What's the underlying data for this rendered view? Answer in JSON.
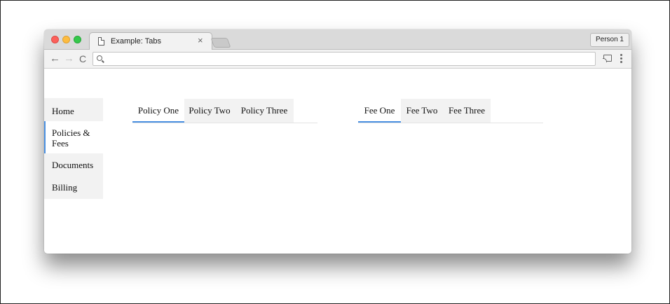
{
  "browser": {
    "tab_title": "Example: Tabs",
    "close_glyph": "×",
    "profile_label": "Person 1",
    "address_value": "",
    "icons": [
      "page-icon",
      "close-icon",
      "back-arrow-icon",
      "forward-arrow-icon",
      "reload-icon",
      "search-icon",
      "cast-icon",
      "more-menu-icon"
    ],
    "glyphs": {
      "back": "←",
      "forward": "→",
      "reload": "C"
    }
  },
  "sidebar": {
    "items": [
      {
        "label": "Home",
        "active": false
      },
      {
        "label": "Policies & Fees",
        "active": true
      },
      {
        "label": "Documents",
        "active": false
      },
      {
        "label": "Billing",
        "active": false
      }
    ]
  },
  "policy_tabs": {
    "items": [
      {
        "label": "Policy One",
        "active": true
      },
      {
        "label": "Policy Two",
        "active": false
      },
      {
        "label": "Policy Three",
        "active": false
      }
    ]
  },
  "fee_tabs": {
    "items": [
      {
        "label": "Fee One",
        "active": true
      },
      {
        "label": "Fee Two",
        "active": false
      },
      {
        "label": "Fee Three",
        "active": false
      }
    ]
  },
  "colors": {
    "accent": "#4a90e2",
    "tab_background": "#f2f2f2",
    "traffic_red": "#fc605b",
    "traffic_yellow": "#fdbc40",
    "traffic_green": "#34c84a"
  }
}
